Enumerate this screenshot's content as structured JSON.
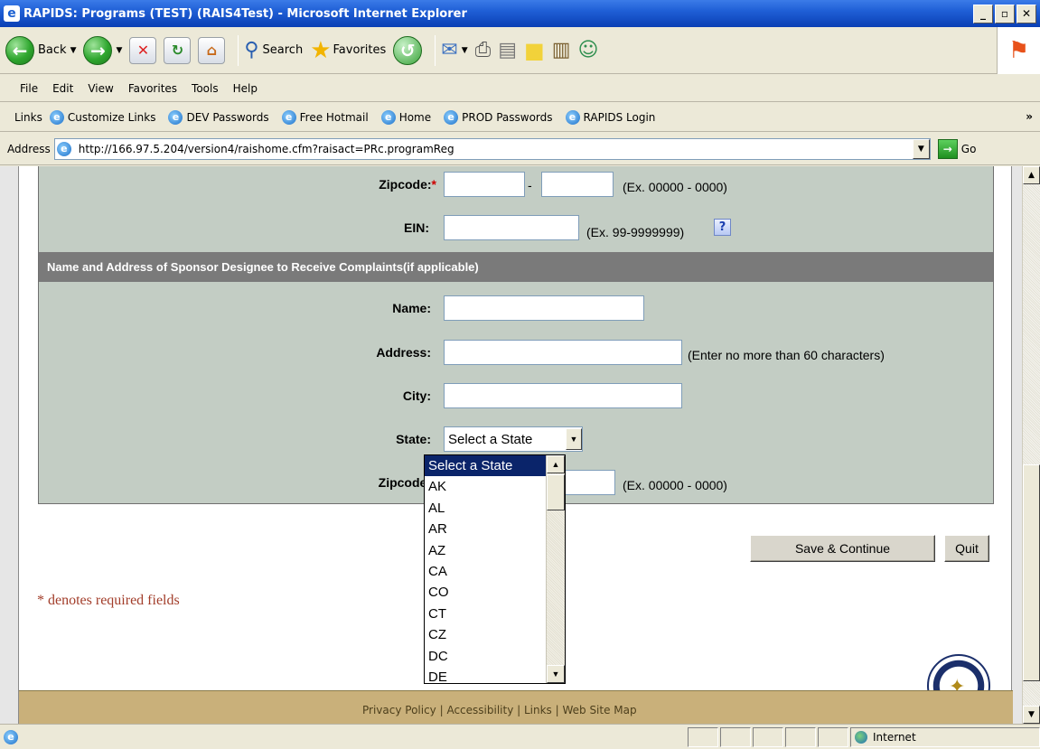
{
  "window": {
    "title": "RAPIDS: Programs  (TEST) (RAIS4Test) - Microsoft Internet Explorer",
    "app_icon": "ie-icon"
  },
  "toolbar": {
    "back_label": "Back",
    "search_label": "Search",
    "favorites_label": "Favorites"
  },
  "menu": {
    "items": [
      "File",
      "Edit",
      "View",
      "Favorites",
      "Tools",
      "Help"
    ]
  },
  "links": {
    "label": "Links",
    "items": [
      "Customize Links",
      "DEV Passwords",
      "Free Hotmail",
      "Home",
      "PROD Passwords",
      "RAPIDS Login"
    ],
    "more": "»"
  },
  "address": {
    "label": "Address",
    "url": "http://166.97.5.204/version4/raishome.cfm?raisact=PRc.programReg",
    "go_label": "Go"
  },
  "form": {
    "zip_label": "Zipcode:",
    "zip_required": "*",
    "zip_dash": "-",
    "zip_hint": "(Ex. 00000 - 0000)",
    "ein_label": "EIN:",
    "ein_hint": "(Ex. 99-9999999)",
    "help_glyph": "?",
    "section_title": "Name and Address of Sponsor Designee to Receive Complaints(if applicable)",
    "name_label": "Name:",
    "address_label": "Address:",
    "address_hint": "(Enter no more than 60 characters)",
    "city_label": "City:",
    "state_label": "State:",
    "state_selected": "Select a State",
    "zip2_label": "Zipcode:",
    "zip2_hint": "(Ex. 00000 - 0000)"
  },
  "state_dropdown": {
    "options": [
      "Select a State",
      "AK",
      "AL",
      "AR",
      "AZ",
      "CA",
      "CO",
      "CT",
      "CZ",
      "DC",
      "DE"
    ],
    "selected_index": 0
  },
  "buttons": {
    "save_continue": "Save & Continue",
    "quit": "Quit"
  },
  "required_note": "* denotes required fields",
  "footer": {
    "text": "Privacy Policy | Accessibility | Links | Web Site Map"
  },
  "status": {
    "zone": "Internet"
  },
  "colors": {
    "form_bg": "#c3cdc4",
    "section_header": "#7a7a7a",
    "dropdown_selected": "#0a246a",
    "required_note": "#a23d2a",
    "footer_bg": "#c9b07a"
  }
}
